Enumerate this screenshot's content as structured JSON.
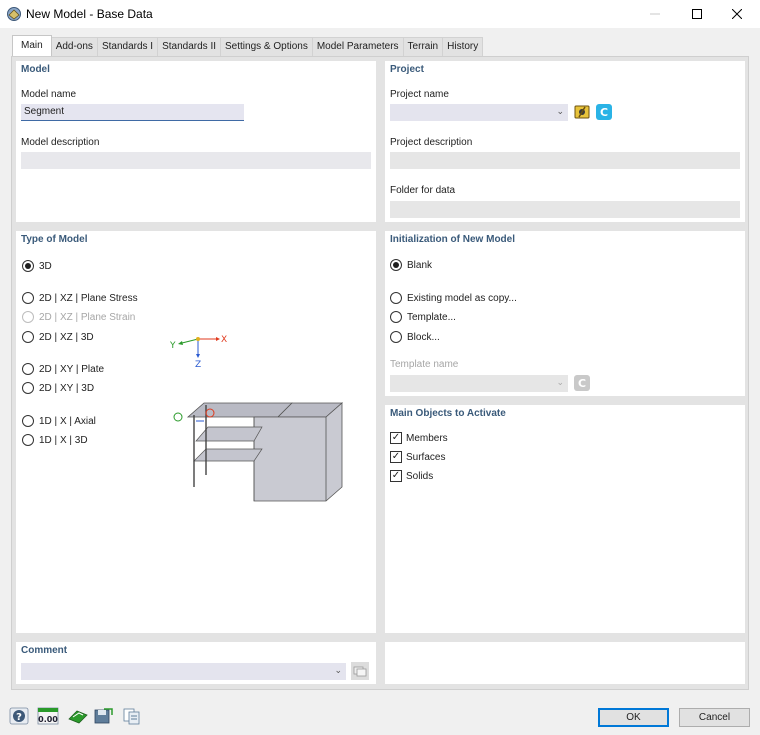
{
  "window": {
    "title": "New Model - Base Data"
  },
  "tabs": [
    {
      "label": "Main"
    },
    {
      "label": "Add-ons"
    },
    {
      "label": "Standards I"
    },
    {
      "label": "Standards II"
    },
    {
      "label": "Settings & Options"
    },
    {
      "label": "Model Parameters"
    },
    {
      "label": "Terrain"
    },
    {
      "label": "History"
    }
  ],
  "active_tab": "Main",
  "model": {
    "section_title": "Model",
    "name_label": "Model name",
    "name_value": "Segment",
    "description_label": "Model description",
    "description_value": ""
  },
  "project": {
    "section_title": "Project",
    "name_label": "Project name",
    "name_value": "",
    "description_label": "Project description",
    "folder_label": "Folder for data"
  },
  "type_of_model": {
    "section_title": "Type of Model",
    "options": [
      {
        "label": "3D",
        "checked": true,
        "enabled": true
      },
      {
        "label": "2D | XZ | Plane Stress",
        "checked": false,
        "enabled": true
      },
      {
        "label": "2D | XZ | Plane Strain",
        "checked": false,
        "enabled": false
      },
      {
        "label": "2D | XZ | 3D",
        "checked": false,
        "enabled": true
      },
      {
        "label": "2D | XY | Plate",
        "checked": false,
        "enabled": true
      },
      {
        "label": "2D | XY | 3D",
        "checked": false,
        "enabled": true
      },
      {
        "label": "1D | X | Axial",
        "checked": false,
        "enabled": true
      },
      {
        "label": "1D | X | 3D",
        "checked": false,
        "enabled": true
      }
    ],
    "axis_labels": {
      "y": "Y",
      "x": "X",
      "z": "Z"
    }
  },
  "initialization": {
    "section_title": "Initialization of New Model",
    "options": [
      {
        "label": "Blank",
        "checked": true
      },
      {
        "label": "Existing model as copy...",
        "checked": false
      },
      {
        "label": "Template...",
        "checked": false
      },
      {
        "label": "Block...",
        "checked": false
      }
    ],
    "template_name_label": "Template name",
    "template_name_value": ""
  },
  "main_objects": {
    "section_title": "Main Objects to Activate",
    "items": [
      {
        "label": "Members",
        "checked": true
      },
      {
        "label": "Surfaces",
        "checked": true
      },
      {
        "label": "Solids",
        "checked": true
      }
    ]
  },
  "comment": {
    "section_title": "Comment",
    "value": ""
  },
  "buttons": {
    "ok": "OK",
    "cancel": "Cancel"
  },
  "toolbar_icons": [
    "help-icon",
    "units-icon",
    "model-info-icon",
    "save-defaults-icon",
    "copy-settings-icon"
  ],
  "units_icon_text": "0.00",
  "colors": {
    "accent": "#0078d7",
    "section_title": "#3a5a7a",
    "active_field_border": "#3f6aa5"
  }
}
